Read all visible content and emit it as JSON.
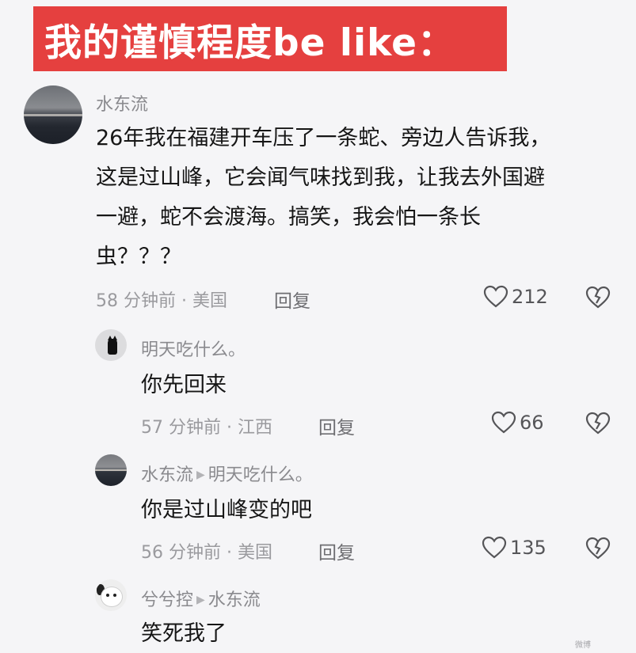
{
  "banner": {
    "title": "我的谨慎程度be like：",
    "color": "#e5403f"
  },
  "comments": [
    {
      "username": "水东流",
      "text_lines": [
        "26年我在福建开车压了一条蛇、旁边人告诉我，",
        "这是过山峰，它会闻气味找到我，让我去外国避",
        "一避，蛇不会渡海。搞笑，我会怕一条长",
        "虫？？？"
      ],
      "meta": "58 分钟前 · 美国",
      "reply_label": "回复",
      "likes": "212",
      "avatar": "horizon-photo-avatar"
    },
    {
      "username": "明天吃什么。",
      "text": "你先回来",
      "meta": "57 分钟前 · 江西",
      "reply_label": "回复",
      "likes": "66",
      "avatar": "black-cat-avatar"
    },
    {
      "username": "水东流",
      "reply_to": "明天吃什么。",
      "text": "你是过山峰变的吧",
      "meta": "56 分钟前 · 美国",
      "reply_label": "回复",
      "likes": "135",
      "avatar": "horizon-photo-avatar"
    },
    {
      "username": "兮兮控",
      "reply_to": "水东流",
      "text": "笑死我了",
      "avatar": "dog-avatar"
    }
  ],
  "icons": {
    "like": "heart-outline-icon",
    "dislike": "broken-heart-icon",
    "reply_arrow": "triangle-right-icon"
  },
  "watermark": "微博"
}
